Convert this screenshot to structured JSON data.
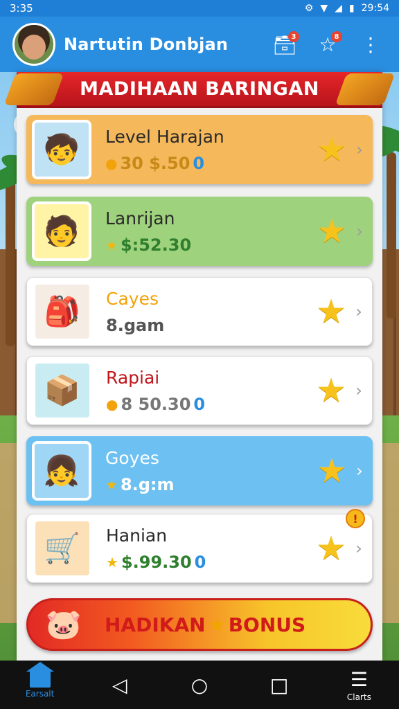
{
  "status": {
    "time": "3:35",
    "clock": "29:54"
  },
  "app": {
    "user_name": "Nartutin Donbjan",
    "notif_count": "3",
    "favorites_count": "8"
  },
  "banner": {
    "title": "MADIHAAN BARINGAN"
  },
  "cards": [
    {
      "title": "Level Harajan",
      "value": "30 $.50",
      "suffix": "0",
      "bg": "#f5b85a",
      "title_color": "#2a2a2a",
      "value_color": "#c78a18",
      "thumb_bg": "#bfe3f5",
      "icon": "🧒"
    },
    {
      "title": "Lanrijan",
      "value": "$:52.30",
      "suffix": "",
      "bg": "#9fd27c",
      "title_color": "#2a2a2a",
      "value_color": "#2f7f2e",
      "thumb_bg": "#fff3a6",
      "icon": "🧑"
    },
    {
      "title": "Cayes",
      "value": "8.gam",
      "suffix": "",
      "bg": "#ffffff",
      "title_color": "#f2a20b",
      "value_color": "#555555",
      "thumb_bg": "#f5ece4",
      "icon": "🎒"
    },
    {
      "title": "Rapiai",
      "value": "8 50.30",
      "suffix": "0",
      "bg": "#ffffff",
      "title_color": "#c0171c",
      "value_color": "#777777",
      "thumb_bg": "#c8ecf2",
      "icon": "📦"
    },
    {
      "title": "Goyes",
      "value": "8.g:m",
      "suffix": "",
      "bg": "#6cc1f2",
      "title_color": "#ffffff",
      "value_color": "#ffffff",
      "thumb_bg": "#9fd6f5",
      "icon": "👧"
    },
    {
      "title": "Hanian",
      "value": "$.99.30",
      "suffix": "0",
      "bg": "#ffffff",
      "title_color": "#2a2a2a",
      "value_color": "#2f7f2e",
      "thumb_bg": "#fbe0b8",
      "icon": "🛒"
    }
  ],
  "bonus": {
    "label_left": "HADIKAN",
    "label_right": "BONUS"
  },
  "nav": {
    "home_label": "Earsalt",
    "menu_label": "Clarts"
  },
  "colors": {
    "app_bar": "#2a8ee0",
    "banner": "#e5262a",
    "star": "#f7c21b"
  }
}
